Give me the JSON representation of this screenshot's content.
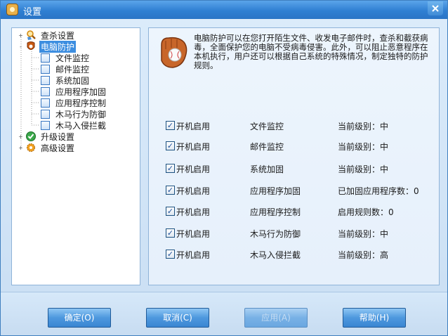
{
  "window": {
    "title": "设置",
    "close_icon": "close-icon"
  },
  "tree": {
    "items": [
      {
        "label": "查杀设置",
        "icon": "magnifier-shield-icon",
        "expander": "+"
      },
      {
        "label": "电脑防护",
        "icon": "glove-shield-icon",
        "expander": "-"
      },
      {
        "label": "文件监控",
        "icon": "document-icon"
      },
      {
        "label": "邮件监控",
        "icon": "document-icon"
      },
      {
        "label": "系统加固",
        "icon": "document-icon"
      },
      {
        "label": "应用程序加固",
        "icon": "document-icon"
      },
      {
        "label": "应用程序控制",
        "icon": "document-icon"
      },
      {
        "label": "木马行为防御",
        "icon": "document-icon"
      },
      {
        "label": "木马入侵拦截",
        "icon": "document-icon"
      },
      {
        "label": "升级设置",
        "icon": "green-check-icon",
        "expander": "+"
      },
      {
        "label": "高级设置",
        "icon": "gear-icon",
        "expander": "+"
      }
    ]
  },
  "main": {
    "description": "电脑防护可以在您打开陌生文件、收发电子邮件时，查杀和截获病毒，全面保护您的电脑不受病毒侵害。此外，可以阻止恶意程序在本机执行，用户还可以根据自己系统的特殊情况，制定独特的防护规则。",
    "rules": [
      {
        "checkbox_label": "开机启用",
        "checked": true,
        "name": "文件监控",
        "status": "当前级别：中"
      },
      {
        "checkbox_label": "开机启用",
        "checked": true,
        "name": "邮件监控",
        "status": "当前级别：中"
      },
      {
        "checkbox_label": "开机启用",
        "checked": true,
        "name": "系统加固",
        "status": "当前级别：中"
      },
      {
        "checkbox_label": "开机启用",
        "checked": true,
        "name": "应用程序加固",
        "status": "已加固应用程序数：0"
      },
      {
        "checkbox_label": "开机启用",
        "checked": true,
        "name": "应用程序控制",
        "status": "启用规则数：0"
      },
      {
        "checkbox_label": "开机启用",
        "checked": true,
        "name": "木马行为防御",
        "status": "当前级别：中"
      },
      {
        "checkbox_label": "开机启用",
        "checked": true,
        "name": "木马入侵拦截",
        "status": "当前级别：高"
      }
    ]
  },
  "buttons": {
    "ok": "确定(O)",
    "cancel": "取消(C)",
    "apply": "应用(A)",
    "help": "帮助(H)"
  },
  "colors": {
    "accent": "#3d8ee0",
    "button": "#4e98de"
  }
}
